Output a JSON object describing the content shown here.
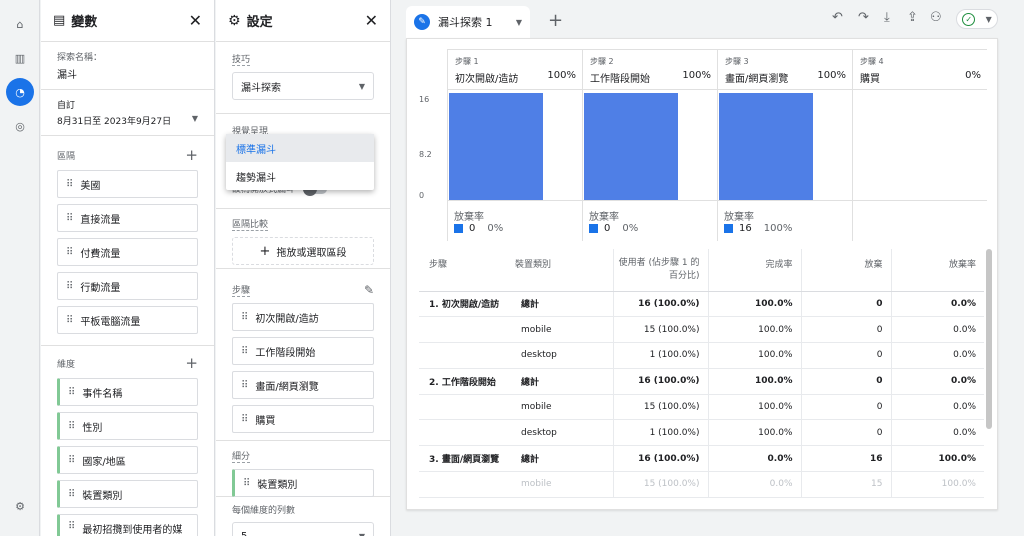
{
  "nav": {
    "items": [
      {
        "name": "home-icon",
        "glyph": "⌂"
      },
      {
        "name": "reports-icon",
        "glyph": "▥"
      },
      {
        "name": "explore-icon",
        "glyph": "◔"
      },
      {
        "name": "advertising-icon",
        "glyph": "◎"
      }
    ],
    "settings_glyph": "⚙"
  },
  "variables": {
    "title": "變數",
    "exploration_name_label": "探索名稱：",
    "exploration_name": "漏斗",
    "date_preset": "自訂",
    "date_range": "8月31日至 2023年9月27日",
    "segments_label": "區隔",
    "segments": [
      "美國",
      "直接流量",
      "付費流量",
      "行動流量",
      "平板電腦流量"
    ],
    "dimensions_label": "維度",
    "dimensions": [
      "事件名稱",
      "性別",
      "國家/地區",
      "裝置類別",
      "最初招攬到使用者的媒介"
    ]
  },
  "settings": {
    "title": "設定",
    "technique_label": "技巧",
    "technique_value": "漏斗探索",
    "visualization_label": "視覺呈現",
    "visualization_options": [
      "標準漏斗",
      "趨勢漏斗"
    ],
    "open_funnel_label": "設為開放式漏斗",
    "segment_compare_label": "區隔比較",
    "segment_dropzone": "拖放或選取區段",
    "steps_label": "步驟",
    "steps": [
      "初次開啟/造訪",
      "工作階段開始",
      "畫面/網頁瀏覽",
      "購買"
    ],
    "breakdown_label": "細分",
    "breakdown_value": "裝置類別",
    "rows_per_dim_label": "每個維度的列數",
    "rows_per_dim_value": "5"
  },
  "tab": {
    "label": "漏斗探索 1",
    "add": "+"
  },
  "toolbar": {
    "undo": "↶",
    "redo": "↷",
    "download": "⤓",
    "share_folder": "⇪",
    "add_user": "⚇"
  },
  "funnel": {
    "y_ticks": [
      "16",
      "8.2",
      "0"
    ],
    "abandon_label": "放棄率",
    "steps": [
      {
        "num": "步驟 1",
        "name": "初次開啟/造訪",
        "pct": "100%",
        "abandon_count": "0",
        "abandon_rate": "0%"
      },
      {
        "num": "步驟 2",
        "name": "工作階段開始",
        "pct": "100%",
        "abandon_count": "0",
        "abandon_rate": "0%"
      },
      {
        "num": "步驟 3",
        "name": "畫面/網頁瀏覽",
        "pct": "100%",
        "abandon_count": "16",
        "abandon_rate": "100%"
      },
      {
        "num": "步驟 4",
        "name": "購買",
        "pct": "0%",
        "abandon_count": "",
        "abandon_rate": ""
      }
    ]
  },
  "chart_data": {
    "type": "bar",
    "categories": [
      "初次開啟/造訪",
      "工作階段開始",
      "畫面/網頁瀏覽",
      "購買"
    ],
    "values": [
      16,
      16,
      16,
      0
    ],
    "ylim": [
      0,
      16
    ]
  },
  "table": {
    "headers": [
      "步驟",
      "裝置類別",
      "使用者 (佔步驟 1 的百分比)",
      "完成率",
      "放棄",
      "放棄率"
    ],
    "rows": [
      {
        "step": "1. 初次開啟/造訪",
        "device": "總計",
        "users": "16 (100.0%)",
        "completion": "100.0%",
        "abandon": "0",
        "abandon_rate": "0.0%",
        "total": true
      },
      {
        "step": "",
        "device": "mobile",
        "users": "15 (100.0%)",
        "completion": "100.0%",
        "abandon": "0",
        "abandon_rate": "0.0%"
      },
      {
        "step": "",
        "device": "desktop",
        "users": "1 (100.0%)",
        "completion": "100.0%",
        "abandon": "0",
        "abandon_rate": "0.0%"
      },
      {
        "step": "2. 工作階段開始",
        "device": "總計",
        "users": "16 (100.0%)",
        "completion": "100.0%",
        "abandon": "0",
        "abandon_rate": "0.0%",
        "total": true
      },
      {
        "step": "",
        "device": "mobile",
        "users": "15 (100.0%)",
        "completion": "100.0%",
        "abandon": "0",
        "abandon_rate": "0.0%"
      },
      {
        "step": "",
        "device": "desktop",
        "users": "1 (100.0%)",
        "completion": "100.0%",
        "abandon": "0",
        "abandon_rate": "0.0%"
      },
      {
        "step": "3. 畫面/網頁瀏覽",
        "device": "總計",
        "users": "16 (100.0%)",
        "completion": "0.0%",
        "abandon": "16",
        "abandon_rate": "100.0%",
        "total": true
      },
      {
        "step": "",
        "device": "mobile",
        "users": "15 (100.0%)",
        "completion": "0.0%",
        "abandon": "15",
        "abandon_rate": "100.0%",
        "fade": true
      }
    ]
  }
}
